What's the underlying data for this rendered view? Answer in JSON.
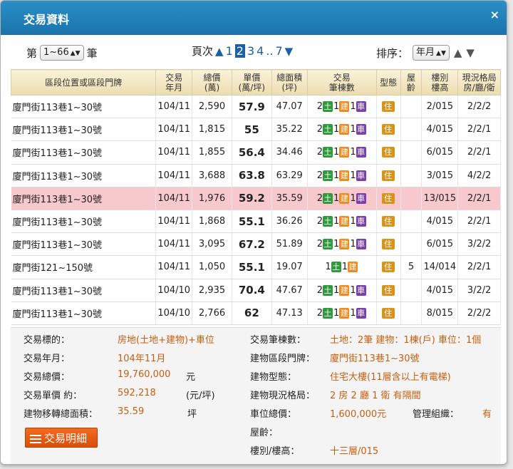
{
  "dialog": {
    "title": "交易資料",
    "close": "×"
  },
  "toolbar": {
    "range_prefix": "第",
    "range_value": "1~66",
    "range_suffix": "筆",
    "page_label": "頁次",
    "pages": [
      "1",
      "2",
      "3",
      "4",
      "..",
      "7"
    ],
    "current_page": "2",
    "sort_label": "排序：",
    "sort_value": "年月"
  },
  "table": {
    "headers": [
      "區段位置或區段門牌",
      "交易\n年月",
      "總價\n(萬)",
      "單價\n(萬/坪)",
      "總面積\n(坪)",
      "交易\n筆棟數",
      "型態",
      "屋\n齡",
      "樓別\n樓高",
      "現況格局\n房/廳/衛"
    ],
    "rows": [
      {
        "addr": "廈門街113巷1~30號",
        "ym": "104/11",
        "total": "2,590",
        "unit": "57.9",
        "area": "47.07",
        "land": "2",
        "bld": "1",
        "car": "1",
        "type": "住",
        "age": "",
        "floor": "2/015",
        "layout": "2/2/2"
      },
      {
        "addr": "廈門街113巷1~30號",
        "ym": "104/11",
        "total": "1,815",
        "unit": "55",
        "area": "35.22",
        "land": "2",
        "bld": "1",
        "car": "1",
        "type": "住",
        "age": "",
        "floor": "4/015",
        "layout": "2/2/1"
      },
      {
        "addr": "廈門街113巷1~30號",
        "ym": "104/11",
        "total": "1,855",
        "unit": "56.4",
        "area": "34.46",
        "land": "2",
        "bld": "1",
        "car": "1",
        "type": "住",
        "age": "",
        "floor": "6/015",
        "layout": "2/2/1"
      },
      {
        "addr": "廈門街113巷1~30號",
        "ym": "104/11",
        "total": "3,688",
        "unit": "63.8",
        "area": "63.29",
        "land": "2",
        "bld": "1",
        "car": "1",
        "type": "住",
        "age": "",
        "floor": "3/015",
        "layout": "4/2/2"
      },
      {
        "addr": "廈門街113巷1~30號",
        "ym": "104/11",
        "total": "1,976",
        "unit": "59.2",
        "area": "35.59",
        "land": "2",
        "bld": "1",
        "car": "1",
        "type": "住",
        "age": "",
        "floor": "13/015",
        "layout": "2/2/1"
      },
      {
        "addr": "廈門街113巷1~30號",
        "ym": "104/11",
        "total": "1,868",
        "unit": "55.1",
        "area": "36.26",
        "land": "2",
        "bld": "1",
        "car": "1",
        "type": "住",
        "age": "",
        "floor": "4/015",
        "layout": "2/2/1"
      },
      {
        "addr": "廈門街113巷1~30號",
        "ym": "104/11",
        "total": "3,095",
        "unit": "67.2",
        "area": "51.89",
        "land": "2",
        "bld": "1",
        "car": "1",
        "type": "住",
        "age": "",
        "floor": "6/015",
        "layout": "3/2/2"
      },
      {
        "addr": "廈門街121~150號",
        "ym": "104/11",
        "total": "1,050",
        "unit": "55.1",
        "area": "19.07",
        "land": "1",
        "bld": "1",
        "car": "",
        "type": "住",
        "age": "5",
        "floor": "14/014",
        "layout": "2/2/1"
      },
      {
        "addr": "廈門街113巷1~30號",
        "ym": "104/10",
        "total": "2,935",
        "unit": "70.4",
        "area": "47.67",
        "land": "2",
        "bld": "1",
        "car": "1",
        "type": "住",
        "age": "",
        "floor": "4/015",
        "layout": "3/2/2"
      },
      {
        "addr": "廈門街113巷1~30號",
        "ym": "104/10",
        "total": "2,766",
        "unit": "62",
        "area": "47.13",
        "land": "2",
        "bld": "1",
        "car": "1",
        "type": "住",
        "age": "",
        "floor": "8/015",
        "layout": "2/2/2"
      }
    ],
    "highlight_row": 4,
    "badge_land": "土",
    "badge_bld": "建",
    "badge_car": "車"
  },
  "detail": {
    "target_label": "交易標的：",
    "target_value": "房地(土地+建物)+車位",
    "ym_label": "交易年月：",
    "ym_value": "104年11月",
    "total_label": "交易總價：",
    "total_value": "19,760,000",
    "total_unit": "元",
    "unit_label": "交易單價 約：",
    "unit_value": "592,218",
    "unit_unit": "(元/坪)",
    "area_label": "建物移轉總面積：",
    "area_value": "35.59",
    "area_unit": "坪",
    "count_label": "交易筆棟數：",
    "count_value": "土地：2筆 建物：1棟(戶) 車位：1個",
    "addr_label": "建物區段門牌：",
    "addr_value": "廈門街113巷1~30號",
    "type_label": "建物型態：",
    "type_value": "住宅大樓(11層含以上有電梯)",
    "layout_label": "建物現況格局：",
    "layout_value": "2 房 2 廳 1 衛 有隔間",
    "parking_label": "車位總價：",
    "parking_value": "1,600,000元",
    "mgmt_label": "管理組織：",
    "mgmt_value": "有",
    "age_label": "屋齡：",
    "floor_label": "樓別/樓高：",
    "floor_value": "十三層/015",
    "button": "交易明細"
  },
  "colors": {
    "titlebar": "#1b74ac",
    "highlight": "#f7c9cc",
    "value": "#c65f10",
    "button": "#e85a12"
  }
}
